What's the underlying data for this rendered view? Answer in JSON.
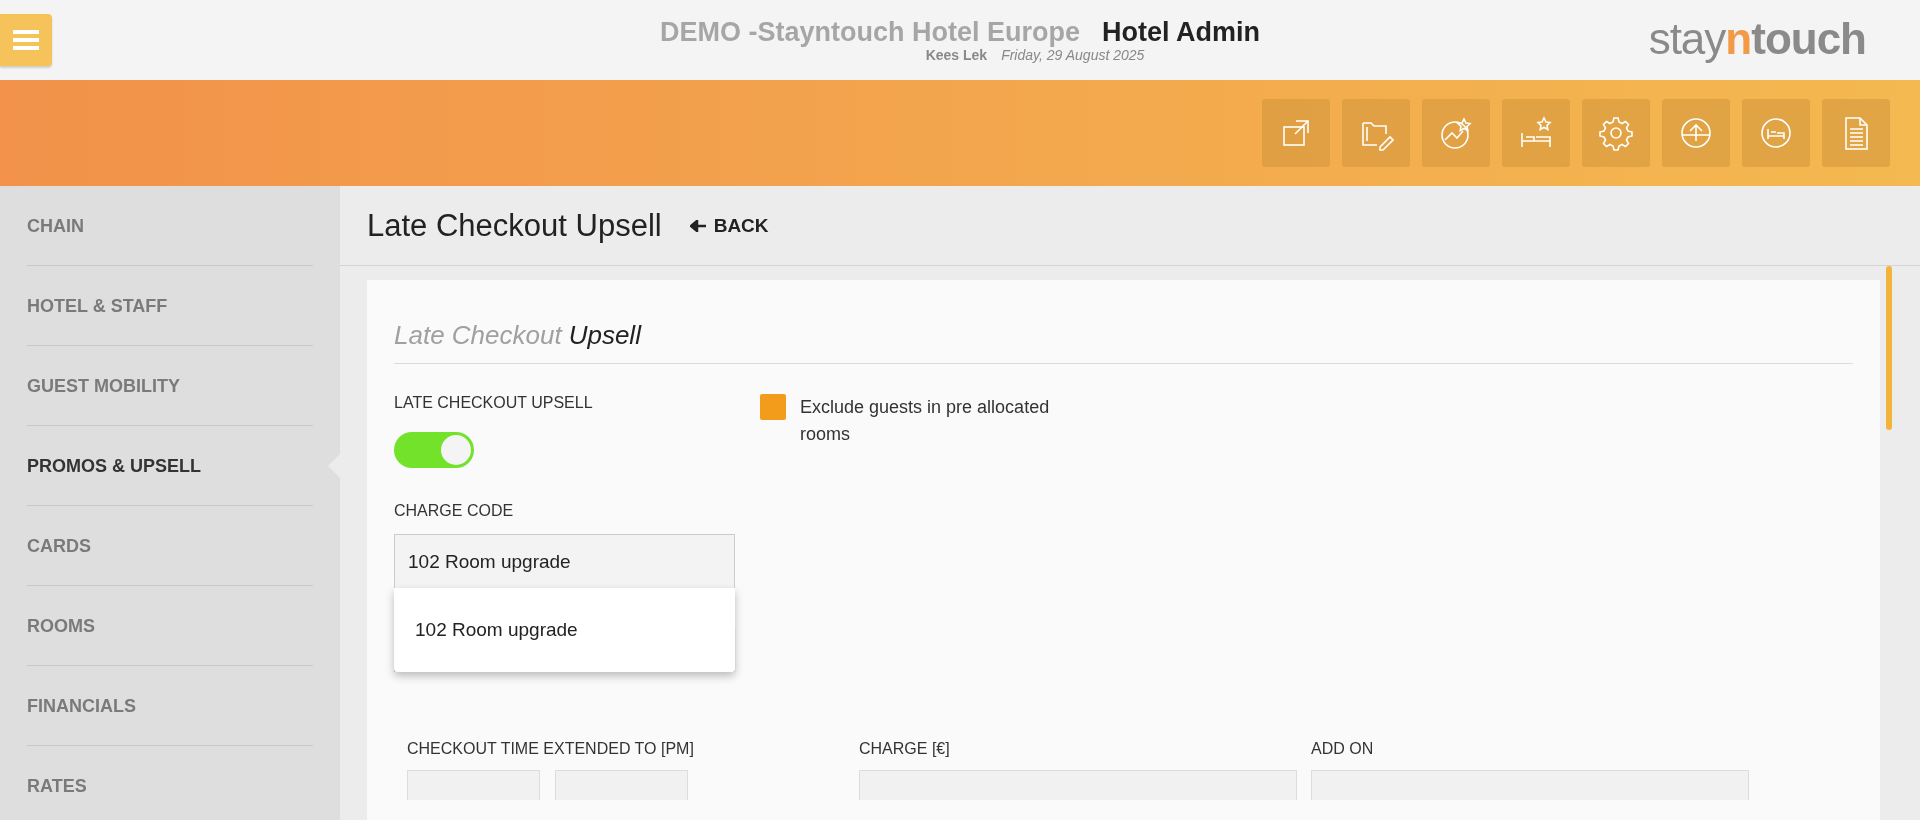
{
  "header": {
    "hotel_name": "DEMO -Stayntouch Hotel Europe",
    "app_title": "Hotel Admin",
    "user": "Kees Lek",
    "date": "Friday, 29 August 2025",
    "logo": [
      "stay",
      "n",
      "touch"
    ]
  },
  "toolbar": [
    {
      "kind": "external-link"
    },
    {
      "kind": "folder-edit"
    },
    {
      "kind": "chart-star"
    },
    {
      "kind": "bed-star"
    },
    {
      "kind": "settings"
    },
    {
      "kind": "upload"
    },
    {
      "kind": "bed-circle"
    },
    {
      "kind": "document"
    }
  ],
  "sidebar": {
    "items": [
      {
        "label": "CHAIN",
        "selected": false
      },
      {
        "label": "HOTEL & STAFF",
        "selected": false
      },
      {
        "label": "GUEST MOBILITY",
        "selected": false
      },
      {
        "label": "PROMOS & UPSELL",
        "selected": true
      },
      {
        "label": "CARDS",
        "selected": false
      },
      {
        "label": "ROOMS",
        "selected": false
      },
      {
        "label": "FINANCIALS",
        "selected": false
      },
      {
        "label": "RATES",
        "selected": false
      }
    ]
  },
  "page": {
    "title": "Late Checkout Upsell",
    "back": "BACK"
  },
  "form": {
    "heading_light": "Late Checkout",
    "heading_dark": "Upsell",
    "upsell_label": "LATE CHECKOUT UPSELL",
    "upsell_on": true,
    "exclude": {
      "label": "Exclude guests in pre allocated rooms",
      "checked": true
    },
    "charge_code": {
      "label": "CHARGE CODE",
      "value": "102 Room upgrade",
      "expanded": true,
      "options": [
        "102 Room upgrade"
      ]
    },
    "columns": [
      {
        "label": "CHECKOUT TIME EXTENDED TO [PM]",
        "kind": "pair"
      },
      {
        "label": "CHARGE [€]",
        "kind": "single"
      },
      {
        "label": "ADD ON",
        "kind": "single"
      }
    ]
  }
}
